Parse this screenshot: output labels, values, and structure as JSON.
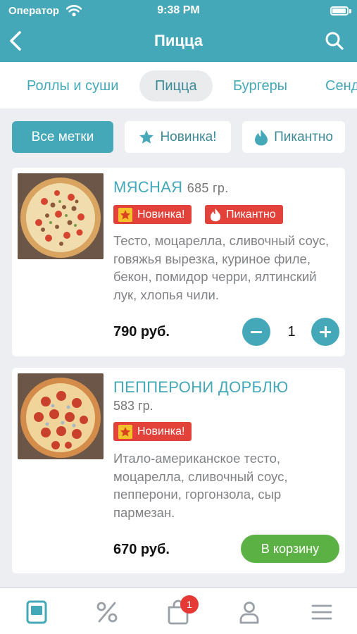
{
  "status_bar": {
    "carrier": "Оператор",
    "time": "9:38 PM"
  },
  "nav": {
    "title": "Пицца"
  },
  "categories": [
    {
      "label": "Роллы и суши"
    },
    {
      "label": "Пицца"
    },
    {
      "label": "Бургеры"
    },
    {
      "label": "Сендвичи"
    }
  ],
  "tag_filters": {
    "all": "Все метки",
    "new": "Новинка!",
    "hot": "Пикантно"
  },
  "products": [
    {
      "name": "МЯСНАЯ",
      "weight": "685 гр.",
      "badges": [
        "Новинка!",
        "Пикантно"
      ],
      "description": "Тесто, моцарелла, сливочный соус, говяжья вырезка, куриное филе, бекон, помидор черри, ялтинский лук, хлопья чили.",
      "price": "790 руб.",
      "quantity": "1"
    },
    {
      "name": "ПЕППЕРОНИ ДОРБЛЮ",
      "weight": "583 гр.",
      "badges": [
        "Новинка!"
      ],
      "description": "Итало-американское тесто, моцарелла, сливочный соус, пепперони, горгонзола, сыр пармезан.",
      "price": "670 руб.",
      "cart_button": "В корзину"
    }
  ],
  "tabbar": {
    "cart_count": "1"
  },
  "colors": {
    "accent": "#45a8b8",
    "badge_red": "#e3423a",
    "cart_green": "#5cb144"
  }
}
